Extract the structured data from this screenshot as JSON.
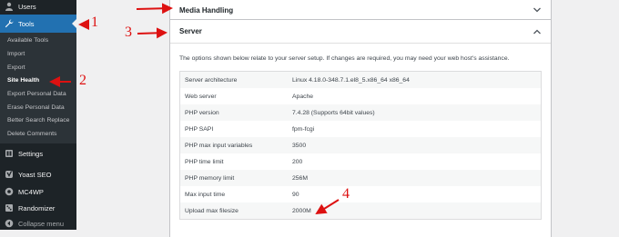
{
  "sidebar": {
    "users": {
      "label": "Users",
      "icon": "users-icon"
    },
    "tools": {
      "label": "Tools",
      "icon": "wrench-icon"
    },
    "submenu": [
      {
        "label": "Available Tools"
      },
      {
        "label": "Import"
      },
      {
        "label": "Export"
      },
      {
        "label": "Site Health",
        "current": true
      },
      {
        "label": "Export Personal Data"
      },
      {
        "label": "Erase Personal Data"
      },
      {
        "label": "Better Search Replace"
      },
      {
        "label": "Delete Comments"
      }
    ],
    "settings": {
      "label": "Settings",
      "icon": "settings-icon"
    },
    "yoast": {
      "label": "Yoast SEO",
      "icon": "yoast-icon"
    },
    "mc4wp": {
      "label": "MC4WP",
      "icon": "mc4wp-icon"
    },
    "randomizer": {
      "label": "Randomizer",
      "icon": "randomizer-icon"
    },
    "collapse": {
      "label": "Collapse menu",
      "icon": "collapse-icon"
    }
  },
  "accordion": {
    "media": {
      "title": "Media Handling",
      "expanded": false
    },
    "server": {
      "title": "Server",
      "expanded": true,
      "description": "The options shown below relate to your server setup. If changes are required, you may need your web host's assistance.",
      "rows": [
        {
          "key": "Server architecture",
          "value": "Linux 4.18.0-348.7.1.el8_5.x86_64 x86_64"
        },
        {
          "key": "Web server",
          "value": "Apache"
        },
        {
          "key": "PHP version",
          "value": "7.4.28 (Supports 64bit values)"
        },
        {
          "key": "PHP SAPI",
          "value": "fpm-fcgi"
        },
        {
          "key": "PHP max input variables",
          "value": "3500"
        },
        {
          "key": "PHP time limit",
          "value": "200"
        },
        {
          "key": "PHP memory limit",
          "value": "256M"
        },
        {
          "key": "Max input time",
          "value": "90"
        },
        {
          "key": "Upload max filesize",
          "value": "2000M"
        }
      ]
    }
  },
  "annotations": {
    "n1": "1",
    "n2": "2",
    "n3": "3",
    "n4": "4",
    "color": "#dd1111"
  },
  "colors": {
    "sidebar_bg": "#1d2327",
    "submenu_bg": "#2c3338",
    "accent": "#2271b1"
  }
}
